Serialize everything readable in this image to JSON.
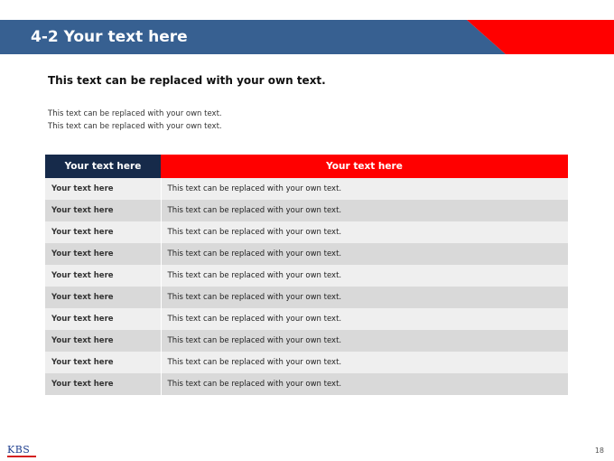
{
  "header": {
    "title": "4-2 Your text here",
    "accent_colors": {
      "blue": "#376091",
      "red": "#ff0000"
    }
  },
  "subtitle": "This text can be replaced with your own text.",
  "body_lines": [
    "This text can be replaced with your own text.",
    "This text can be replaced with your own text."
  ],
  "table": {
    "headers": [
      "Your text here",
      "Your text here"
    ],
    "rows": [
      [
        "Your text here",
        "This text can be replaced with your own text."
      ],
      [
        "Your text here",
        "This text can be replaced with your own text."
      ],
      [
        "Your text here",
        "This text can be replaced with your own text."
      ],
      [
        "Your text here",
        "This text can be replaced with your own text."
      ],
      [
        "Your text here",
        "This text can be replaced with your own text."
      ],
      [
        "Your text here",
        "This text can be replaced with your own text."
      ],
      [
        "Your text here",
        "This text can be replaced with your own text."
      ],
      [
        "Your text here",
        "This text can be replaced with your own text."
      ],
      [
        "Your text here",
        "This text can be replaced with your own text."
      ],
      [
        "Your text here",
        "This text can be replaced with your own text."
      ]
    ]
  },
  "footer": {
    "logo_text": "KBS",
    "page_number": "18"
  }
}
